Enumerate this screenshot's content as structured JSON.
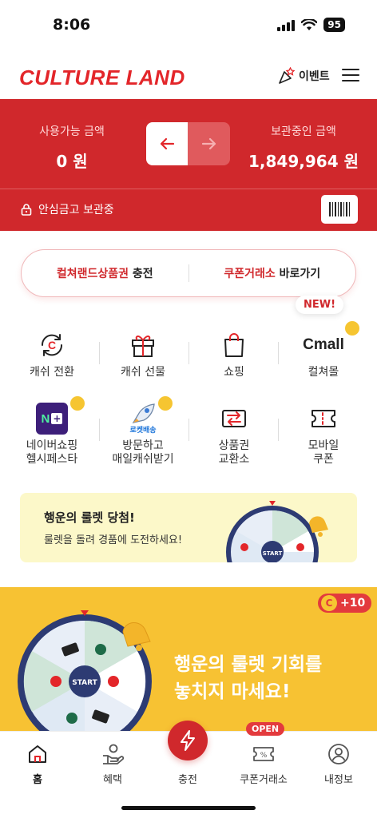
{
  "status_bar": {
    "time": "8:06",
    "battery": "95"
  },
  "header": {
    "logo": "CULTURE LAND",
    "event_label": "이벤트"
  },
  "balance": {
    "available_label": "사용가능 금액",
    "available_value": "0 원",
    "stored_label": "보관중인 금액",
    "stored_value": "1,849,964 원",
    "safe_label": "안심금고 보관중"
  },
  "quick_links": {
    "charge_red": "컬쳐랜드상품권",
    "charge_black": " 충전",
    "coupon_red": "쿠폰거래소",
    "coupon_black": " 바로가기"
  },
  "new_badge": "NEW!",
  "menu": [
    {
      "label": "캐쉬 전환",
      "icon": "cash-convert-icon"
    },
    {
      "label": "캐쉬 선물",
      "icon": "gift-icon"
    },
    {
      "label": "쇼핑",
      "icon": "shopping-bag-icon"
    },
    {
      "label": "컬쳐몰",
      "icon": "cmall-logo"
    },
    {
      "label": "네이버쇼핑\n헬시페스타",
      "icon": "naver-plus-icon"
    },
    {
      "label": "방문하고\n매일캐쉬받기",
      "icon": "rocket-icon"
    },
    {
      "label": "상품권\n교환소",
      "icon": "exchange-icon"
    },
    {
      "label": "모바일\n쿠폰",
      "icon": "ticket-icon"
    }
  ],
  "cmall_logo": "Cmall",
  "rocket_caption": "로켓배송",
  "roulette_small": {
    "title": "행운의 룰렛 당첨!",
    "subtitle": "룰렛을 돌려 경품에 도전하세요!",
    "start": "START"
  },
  "roulette_big": {
    "line1": "행운의 룰렛 기회를",
    "line2": "놓치지 마세요!",
    "badge": "+10",
    "badge_coin": "C",
    "start": "START"
  },
  "tabbar": {
    "items": [
      {
        "label": "홈",
        "icon": "home-icon"
      },
      {
        "label": "혜택",
        "icon": "benefit-icon"
      },
      {
        "label": "충전",
        "icon": "lightning-icon"
      },
      {
        "label": "쿠폰거래소",
        "icon": "coupon-icon"
      },
      {
        "label": "내정보",
        "icon": "user-icon"
      }
    ],
    "open_badge": "OPEN"
  },
  "colors": {
    "brand_red": "#d0282c",
    "banner_yellow": "#f7c233",
    "light_yellow": "#fcf8c9"
  }
}
